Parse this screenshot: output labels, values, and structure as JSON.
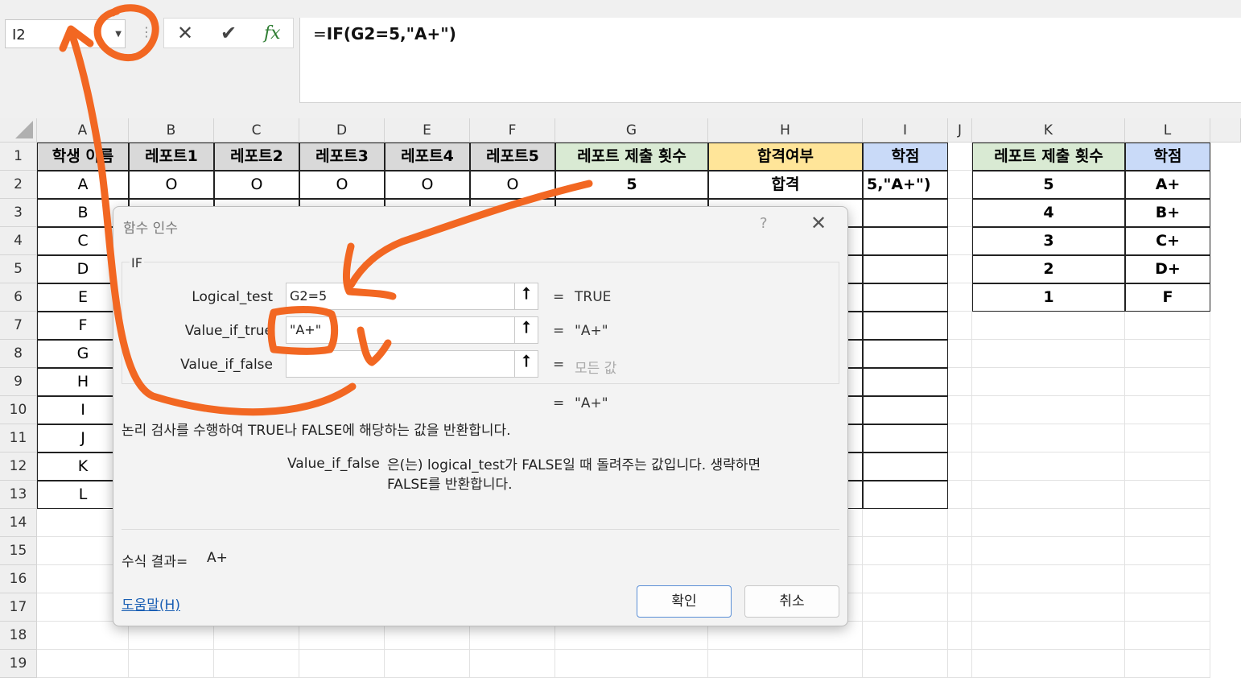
{
  "formula_bar": {
    "name_box": "I2",
    "formula_prefix": "=",
    "formula_body": "IF(G2=5,\"A+\")",
    "cancel_icon": "✕",
    "enter_icon": "✔",
    "fx_icon": "fx"
  },
  "columns": [
    "A",
    "B",
    "C",
    "D",
    "E",
    "F",
    "G",
    "H",
    "I",
    "J",
    "K",
    "L"
  ],
  "rows": [
    "1",
    "2",
    "3",
    "4",
    "5",
    "6",
    "7",
    "8",
    "9",
    "10",
    "11",
    "12",
    "13",
    "14",
    "15",
    "16",
    "17",
    "18",
    "19"
  ],
  "table1": {
    "headers": [
      "학생 이름",
      "레포트1",
      "레포트2",
      "레포트3",
      "레포트4",
      "레포트5",
      "레포트 제출 횟수",
      "합격여부",
      "학점"
    ],
    "row2": [
      "A",
      "O",
      "O",
      "O",
      "O",
      "O",
      "5",
      "합격",
      "5,\"A+\")"
    ],
    "names": [
      "B",
      "C",
      "D",
      "E",
      "F",
      "G",
      "H",
      "I",
      "J",
      "K",
      "L"
    ]
  },
  "table2": {
    "headers": [
      "레포트 제출 횟수",
      "학점"
    ],
    "rows": [
      [
        "5",
        "A+"
      ],
      [
        "4",
        "B+"
      ],
      [
        "3",
        "C+"
      ],
      [
        "2",
        "D+"
      ],
      [
        "1",
        "F"
      ]
    ]
  },
  "colors": {
    "green_header": "#d9ead3",
    "yellow_header": "#ffe599",
    "blue_header": "#c9daf8",
    "name_header": "#d9d9d9",
    "annotation": "#f26722"
  },
  "dialog": {
    "title": "함수 인수",
    "help_icon": "?",
    "close_icon": "✕",
    "function_name": "IF",
    "args": [
      {
        "label": "Logical_test",
        "value": "G2=5",
        "result": "TRUE"
      },
      {
        "label": "Value_if_true",
        "value": "\"A+\"",
        "result": "\"A+\""
      },
      {
        "label": "Value_if_false",
        "value": "",
        "result": "모든 값"
      }
    ],
    "equals": "=",
    "overall_result": "\"A+\"",
    "description": "논리 검사를 수행하여 TRUE나 FALSE에 해당하는 값을 반환합니다.",
    "arg_name": "Value_if_false",
    "arg_description": "은(는) logical_test가 FALSE일 때 돌려주는 값입니다. 생략하면 FALSE를 반환합니다.",
    "formula_result_label": "수식 결과=",
    "formula_result_value": "A+",
    "help_link": "도움말(H)",
    "ok": "확인",
    "cancel": "취소"
  }
}
